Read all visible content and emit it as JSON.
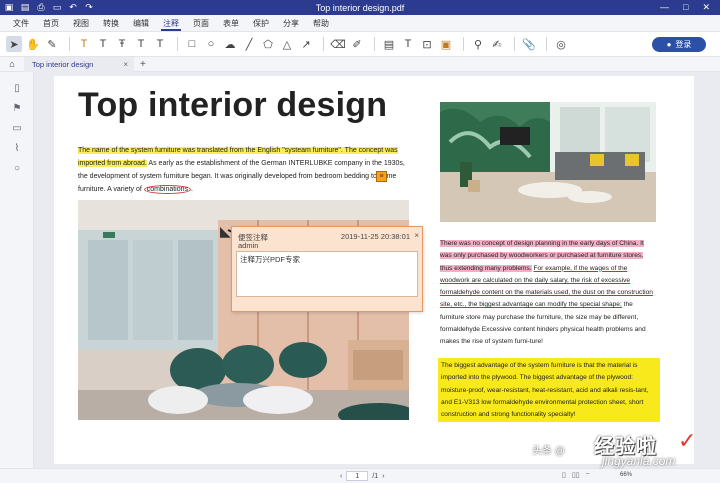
{
  "window": {
    "title": "Top interior design.pdf",
    "controls": [
      "—",
      "□",
      "✕"
    ]
  },
  "menu": {
    "items": [
      "文件",
      "首页",
      "视图",
      "转换",
      "编辑",
      "注释",
      "页面",
      "表单",
      "保护",
      "分享",
      "帮助"
    ],
    "active_index": 5
  },
  "toolbar": {
    "login_label": "登录"
  },
  "tabs": {
    "doc_tab": "Top interior design",
    "close": "×",
    "new": "+"
  },
  "document": {
    "heading": "Top interior design",
    "para1": {
      "hl1": "The name of the system furniture was translated from the English \"systeam furniture\". The concept was imported from abroad.",
      "rest1": " As early as the establishment of the German INTERLUBKE company in the 1930s, the development of system furniture began. It was originally developed from bedroom bedding to home furniture. A variety of ",
      "circled": "combinations",
      "rest2": "."
    },
    "para2": {
      "pink": "There was no concept of design planning in the early days of China. It was only purchased by woodworkers or purchased at furniture stores, thus extending many problems.",
      "underlined": "For example, if the wages of the woodwork are calculated on the daily salary, the risk of excessive formaldehyde content on the materials used, the dust on the construction site, etc., the biggest advantage can modify the special shape;",
      "rest": " the furniture store may purchase the furniture, the size may be different, formaldehyde Excessive content hinders physical health problems and makes the rise of system furni-ture!"
    },
    "para3": "The biggest advantage of the system furniture is that the material is imported into the plywood. The biggest advantage of the plywood: moisture-proof, wear-resistant, heat-resistant, acid and alkali resis-tant, and E1-V313 low formaldehyde environmental protection sheet, short construction and strong functionality specialty!"
  },
  "popup_note": {
    "title": "便签注释",
    "author": "admin",
    "date": "2019-11-25 20:38:01",
    "close": "×",
    "content": "注释万兴PDF专家"
  },
  "status": {
    "page": "1",
    "page_total": "/1",
    "zoom": "66%"
  },
  "watermark": {
    "small": "头条 @",
    "big": "经验啦",
    "url": "jingyanla.com",
    "check": "✓"
  },
  "colors": {
    "titlebar": "#2c3a8f",
    "highlight_yellow": "#f7ee5a",
    "highlight_pink": "#f2b0c6",
    "note_orange": "#f2a31b",
    "popup_bg": "#fbe3cf"
  }
}
